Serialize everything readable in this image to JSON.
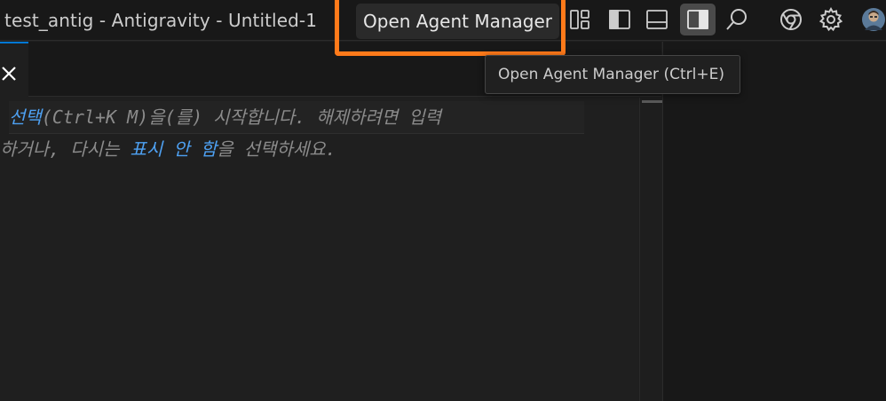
{
  "window": {
    "title": "test_antig - Antigravity - Untitled-1"
  },
  "toolbar": {
    "agent_manager_label": "Open Agent Manager",
    "icons": [
      "layout-icon",
      "toggle-primary-sidebar-icon",
      "toggle-panel-icon",
      "toggle-secondary-sidebar-icon",
      "search-icon",
      "chrome-icon",
      "settings-gear-icon",
      "account-avatar"
    ]
  },
  "tooltip": {
    "text": "Open Agent Manager (Ctrl+E)"
  },
  "editor": {
    "hint_line1_kw": "선택",
    "hint_line1_rest": "(Ctrl+K M)을(를) 시작합니다. 해제하려면 입력",
    "hint_line2_pre": "하거나, 다시는 ",
    "hint_line2_kw": "표시 안 함",
    "hint_line2_post": "을 선택하세요."
  },
  "colors": {
    "highlight": "#ff7a1a",
    "link": "#4ea1f3",
    "active_tab_accent": "#0078d4"
  }
}
